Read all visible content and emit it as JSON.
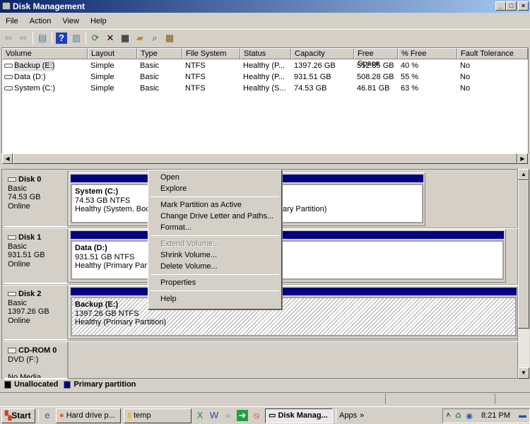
{
  "window": {
    "title": "Disk Management"
  },
  "menu": [
    "File",
    "Action",
    "View",
    "Help"
  ],
  "toolbar": [
    "back-icon",
    "forward-icon",
    "console-tree-icon",
    "help-icon",
    "action-pane-icon",
    "refresh-icon",
    "delete-icon",
    "properties-icon",
    "open-icon",
    "explore-icon",
    "settings-icon"
  ],
  "list": {
    "columns": [
      "Volume",
      "Layout",
      "Type",
      "File System",
      "Status",
      "Capacity",
      "Free Space",
      "% Free",
      "Fault Tolerance"
    ],
    "rows": [
      [
        "Backup (E:)",
        "Simple",
        "Basic",
        "NTFS",
        "Healthy (P...",
        "1397.26 GB",
        "552.85 GB",
        "40 %",
        "No"
      ],
      [
        "Data (D:)",
        "Simple",
        "Basic",
        "NTFS",
        "Healthy (P...",
        "931.51 GB",
        "508.28 GB",
        "55 %",
        "No"
      ],
      [
        "System (C:)",
        "Simple",
        "Basic",
        "NTFS",
        "Healthy (S...",
        "74.53 GB",
        "46.81 GB",
        "63 %",
        "No"
      ]
    ]
  },
  "disks": [
    {
      "name": "Disk 0",
      "type": "Basic",
      "size": "74.53 GB",
      "state": "Online",
      "part_name": "System  (C:)",
      "part_size": "74.53 GB NTFS",
      "part_status": "Healthy (System, Boot, Page File, Active, Crash Dump, Primary Partition)"
    },
    {
      "name": "Disk 1",
      "type": "Basic",
      "size": "931.51 GB",
      "state": "Online",
      "part_name": "Data  (D:)",
      "part_size": "931.51 GB NTFS",
      "part_status": "Healthy (Primary Partition)"
    },
    {
      "name": "Disk 2",
      "type": "Basic",
      "size": "1397.26 GB",
      "state": "Online",
      "part_name": "Backup  (E:)",
      "part_size": "1397.26 GB NTFS",
      "part_status": "Healthy (Primary Partition)"
    }
  ],
  "cdrom": {
    "name": "CD-ROM 0",
    "drive": "DVD (F:)",
    "state": "No Media"
  },
  "legend": {
    "unallocated": "Unallocated",
    "primary": "Primary partition",
    "unallocated_color": "#000000",
    "primary_color": "#000080"
  },
  "context_menu": {
    "open": "Open",
    "explore": "Explore",
    "mark_active": "Mark Partition as Active",
    "change_letter": "Change Drive Letter and Paths...",
    "format": "Format...",
    "extend": "Extend Volume...",
    "shrink": "Shrink Volume...",
    "delete": "Delete Volume...",
    "properties": "Properties",
    "help": "Help"
  },
  "taskbar": {
    "start": "Start",
    "firefox": "Hard drive p...",
    "temp": "temp",
    "disk": "Disk Manag...",
    "apps": "Apps",
    "clock": "8:21 PM"
  }
}
